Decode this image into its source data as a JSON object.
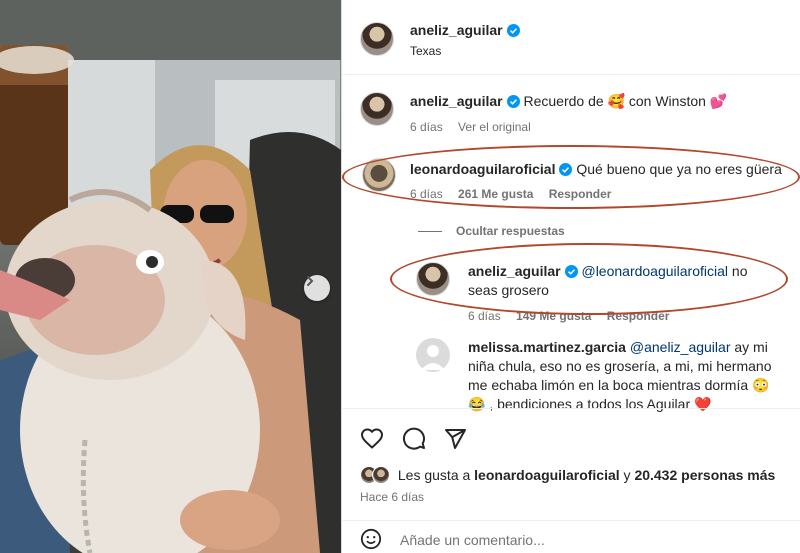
{
  "post_header": {
    "username": "aneliz_aguilar",
    "location": "Texas"
  },
  "caption": {
    "username": "aneliz_aguilar",
    "text_before": "Recuerdo de",
    "text_after": "con Winston",
    "emoji_face": "🥰",
    "emoji_heart": "💕",
    "time": "6 días",
    "see_original": "Ver el original"
  },
  "comments": [
    {
      "username": "leonardoaguilaroficial",
      "text": "Qué bueno que ya no eres güera",
      "time": "6 días",
      "likes": "261 Me gusta",
      "reply": "Responder"
    },
    {
      "username": "aneliz_aguilar",
      "mention": "@leonardoaguilaroficial",
      "text": "no seas grosero",
      "time": "6 días",
      "likes": "149 Me gusta",
      "reply": "Responder"
    },
    {
      "username": "melissa.martinez.garcia",
      "mention": "@aneliz_aguilar",
      "text": "ay mi niña chula, eso no es grosería, a mi, mi hermano me echaba limón en la boca mientras dormía 😳 😂 , bendiciones a todos los Aguilar ❤️"
    }
  ],
  "hide_replies": "Ocultar respuestas",
  "actions": {
    "like_icon": "heart-outline-icon",
    "comment_icon": "comment-bubble-icon",
    "share_icon": "paper-plane-icon"
  },
  "likes_summary": {
    "prefix": "Les gusta a",
    "user": "leonardoaguilaroficial",
    "connector": "y",
    "count": "20.432 personas más"
  },
  "posted": "Hace 6 días",
  "comment_box": {
    "placeholder": "Añade un comentario..."
  },
  "colors": {
    "verified": "#0095f6",
    "highlight_ring": "#b2472c",
    "mention": "#00376b",
    "muted": "#737373"
  }
}
